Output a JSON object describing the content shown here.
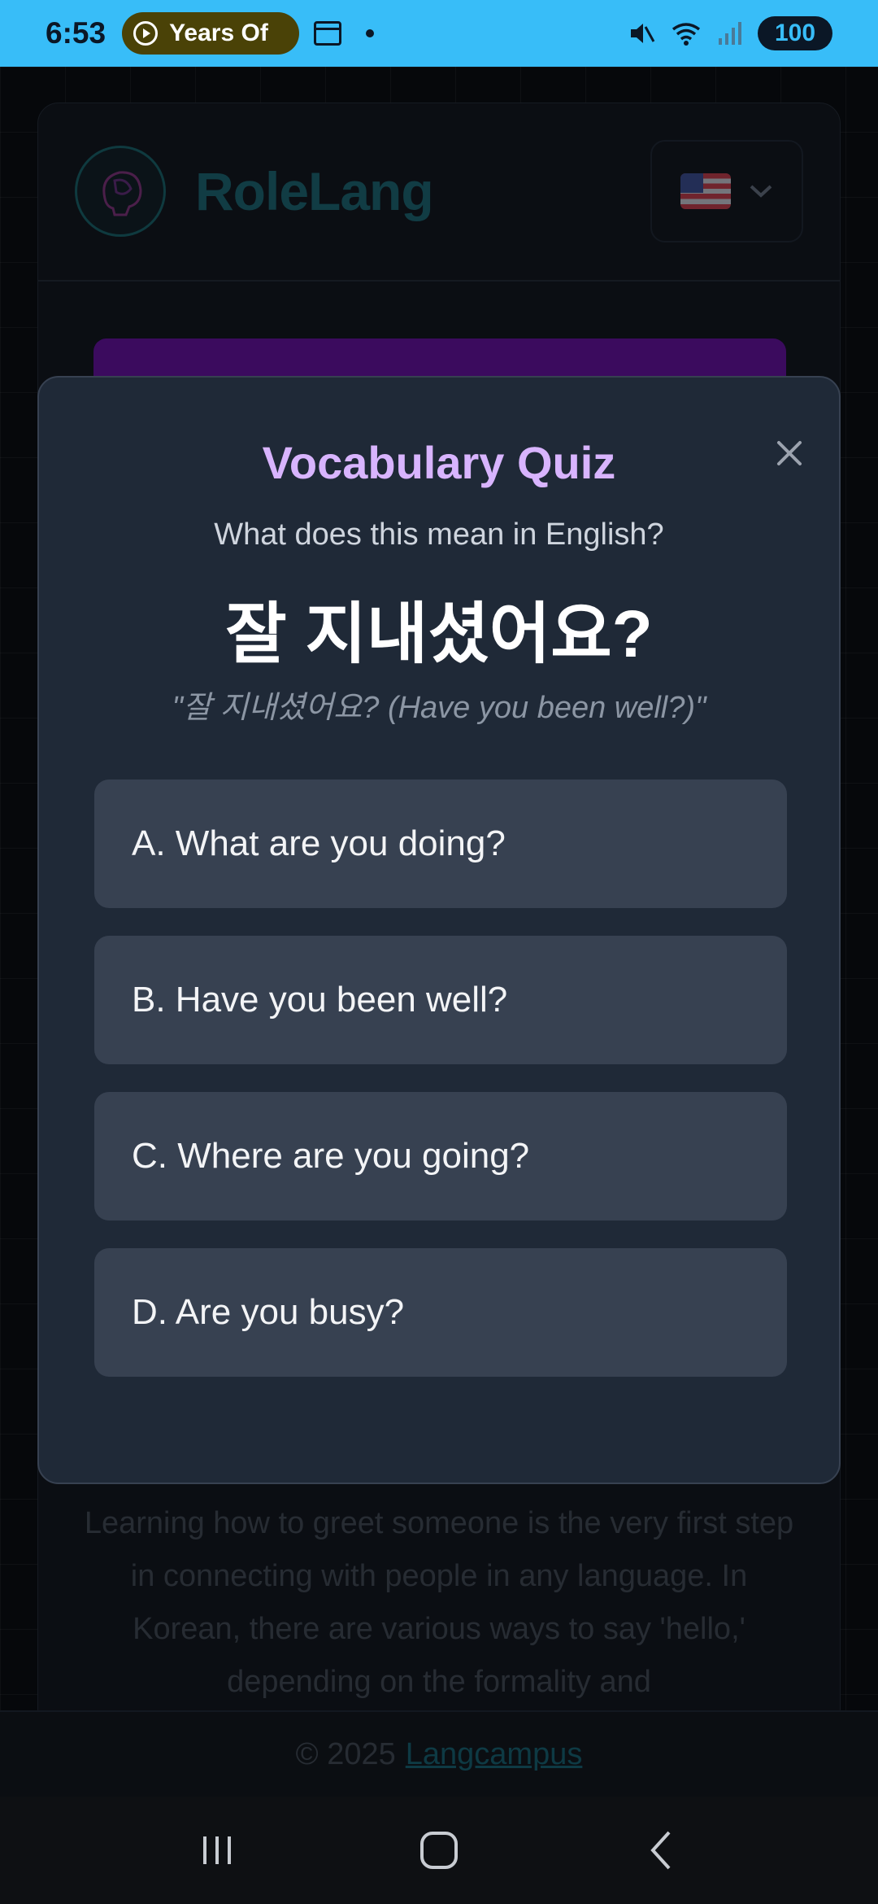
{
  "status_bar": {
    "time": "6:53",
    "media_label": "Years Of",
    "battery": "100",
    "icons": [
      "play-icon",
      "calendar-icon",
      "dot-icon",
      "mute-icon",
      "wifi-icon",
      "signal-icon",
      "battery-icon"
    ]
  },
  "header": {
    "brand": "RoleLang",
    "language_flag": "us-flag-icon"
  },
  "background": {
    "paragraph": "Learning how to greet someone is the very first step in connecting with people in any language. In Korean, there are various ways to say 'hello,' depending on the formality and"
  },
  "modal": {
    "title": "Vocabulary Quiz",
    "prompt": "What does this mean in English?",
    "word": "잘 지내셨어요?",
    "example": "\"잘 지내셨어요? (Have you been well?)\"",
    "options": [
      "A. What are you doing?",
      "B. Have you been well?",
      "C. Where are you going?",
      "D. Are you busy?"
    ]
  },
  "footer": {
    "copyright": "© 2025",
    "link": "Langcampus"
  },
  "colors": {
    "status_bar": "#38bdf8",
    "modal_bg": "#1f2937",
    "option_bg": "#374151",
    "title_accent": "#d8b4fe"
  }
}
